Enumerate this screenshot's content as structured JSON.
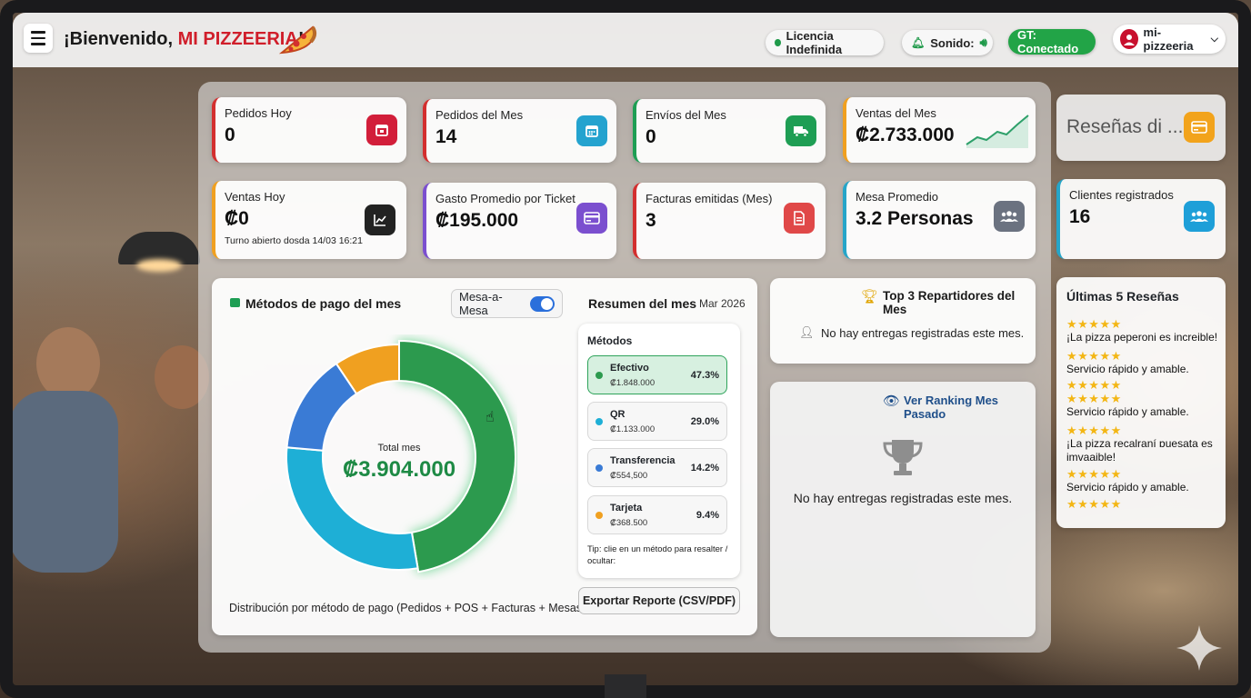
{
  "header": {
    "welcome_prefix": "¡Bienvenido, ",
    "brand": "MI PIZZEERIA",
    "welcome_suffix": "!",
    "license_label": "Licencia Indefinida",
    "sound_label": "Sonido:",
    "gt_label": "GT: Conectado",
    "user_name": "mi-pizzeeria"
  },
  "stats": [
    {
      "label": "Pedidos Hoy",
      "value": "0",
      "icon": "calendar-icon",
      "color": "#d32f2f"
    },
    {
      "label": "Pedidos del Mes",
      "value": "14",
      "icon": "calendar-grid-icon",
      "color": "#26a5c8"
    },
    {
      "label": "Envíos del Mes",
      "value": "0",
      "icon": "truck-icon",
      "color": "#1e9e54"
    },
    {
      "label": "Ventas del Mes",
      "value": "₡2.733.000",
      "icon": "trend-line-icon",
      "color": "#f0a020"
    },
    {
      "label": "Ventas Hoy",
      "value": "₡0",
      "sub": "Turno abierto dosda 14/03 16:21",
      "icon": "chart-line-icon",
      "color": "#222222"
    },
    {
      "label": "Gasto Promedio por Ticket",
      "value": "₡195.000",
      "icon": "card-icon",
      "color": "#7b4fcf"
    },
    {
      "label": "Facturas emitidas (Mes)",
      "value": "3",
      "icon": "invoice-icon",
      "color": "#d32f2f"
    },
    {
      "label": "Mesa Promedio",
      "value": "3.2 Personas",
      "icon": "group-icon",
      "color": "#6b7280"
    }
  ],
  "side": {
    "reviews_title": "Reseñas di ...",
    "clients_label": "Clientes registrados",
    "clients_value": "16",
    "last_reviews_title": "Últimas 5 Reseñas",
    "reviews": [
      {
        "stars": "★★★★★",
        "text": "¡La pizza peperoni es increible!"
      },
      {
        "stars": "★★★★★",
        "text": "Servicio rápido y amable."
      },
      {
        "stars": "★★★★★",
        "text": "Servicio rápido y amable."
      },
      {
        "stars": "★★★★★",
        "text": "¡La pizza recalraní ɒuesata es imvaaible!"
      },
      {
        "stars": "★★★★★",
        "text": "Servicio rápido y amable."
      }
    ],
    "trailing_stars": "★★★★★"
  },
  "payments": {
    "title": "Métodos de pago del mes",
    "toggle_label": "Mesa-a-Mesa",
    "summary_title": "Resumen del mes",
    "summary_period": "Mar 2026",
    "methods_title": "Métodos",
    "total_label": "Total mes",
    "total_value": "₡3.904.000",
    "footer_text": "Distribución por método de pago (Pedidos + POS  + Facturas + Mesas).",
    "tip": "Tip: clie en un método para resalter / ocultar:",
    "export_label": "Exportar Reporte (CSV/PDF)"
  },
  "chart_data": {
    "type": "pie",
    "variant": "donut",
    "categories": [
      "Efectivo",
      "QR",
      "Transferencia",
      "Tarjeta"
    ],
    "amounts": [
      "₡1.848.000",
      "₡1.133.000",
      "₡554,500",
      "₡368.500"
    ],
    "percents": [
      "47.3%",
      "29.0%",
      "14.2%",
      "9.4%"
    ],
    "values": [
      47.3,
      29.0,
      14.2,
      9.4
    ],
    "colors": [
      "#2c9a4e",
      "#1eafd6",
      "#3a7bd5",
      "#f0a020"
    ],
    "highlighted": "Efectivo"
  },
  "repartidores": {
    "title": "Top 3 Repartidores del Mes",
    "empty_text": "No hay entregas registradas este mes.",
    "ranking_link": "Ver Ranking Mes Pasado",
    "empty_text_2": "No hay entregas registradas este mes."
  }
}
